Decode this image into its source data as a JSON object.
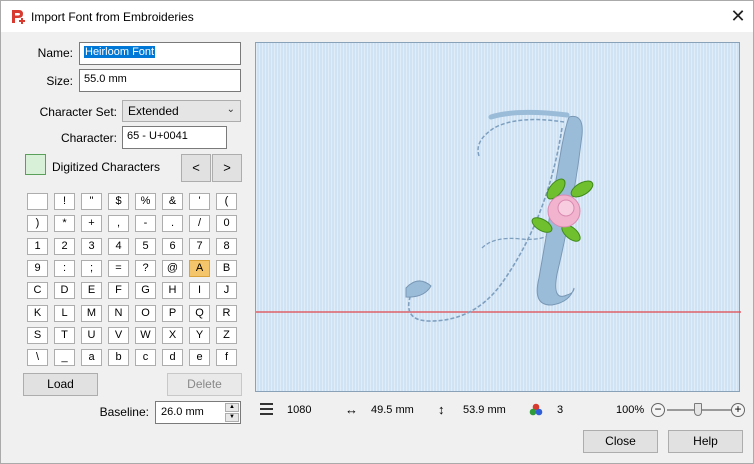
{
  "window": {
    "title": "Import Font from Embroideries"
  },
  "form": {
    "name_label": "Name:",
    "name_value": "Heirloom Font",
    "size_label": "Size:",
    "size_value": "55.0 mm",
    "charset_label": "Character Set:",
    "charset_value": "Extended",
    "character_label": "Character:",
    "character_value": "65 - U+0041",
    "digitized_label": "Digitized Characters",
    "prev_label": "<",
    "next_label": ">"
  },
  "characters": [
    " ",
    "!",
    "\"",
    "$",
    "%",
    "&",
    "'",
    "(",
    ")",
    "*",
    "+",
    ",",
    "-",
    ".",
    "/",
    "0",
    "1",
    "2",
    "3",
    "4",
    "5",
    "6",
    "7",
    "8",
    "9",
    ":",
    ";",
    "=",
    "?",
    "@",
    "A",
    "B",
    "C",
    "D",
    "E",
    "F",
    "G",
    "H",
    "I",
    "J",
    "K",
    "L",
    "M",
    "N",
    "O",
    "P",
    "Q",
    "R",
    "S",
    "T",
    "U",
    "V",
    "W",
    "X",
    "Y",
    "Z",
    "\\",
    "_",
    "a",
    "b",
    "c",
    "d",
    "e",
    "f"
  ],
  "active_character": "A",
  "buttons": {
    "load": "Load",
    "delete": "Delete",
    "close": "Close",
    "help": "Help"
  },
  "baseline": {
    "label": "Baseline:",
    "value": "26.0 mm"
  },
  "status": {
    "stitches": "1080",
    "width": "49.5 mm",
    "height": "53.9 mm",
    "colors": "3",
    "zoom": "100%",
    "zoom_level_percent": 100
  },
  "colors": {
    "accent": "#0078d7",
    "active_cell": "#f5c56b",
    "canvas_bg": "#cfe3f5",
    "baseline_line": "#e0474c",
    "letter": "#9bbcd8",
    "leaf": "#6fbf2f",
    "rose": "#f2b3cf"
  },
  "icons": {
    "app": "app-logo-icon",
    "close": "close-icon",
    "stitches": "stitch-count-icon",
    "width": "horizontal-arrow-icon",
    "height": "vertical-arrow-icon",
    "colors": "color-dots-icon"
  }
}
